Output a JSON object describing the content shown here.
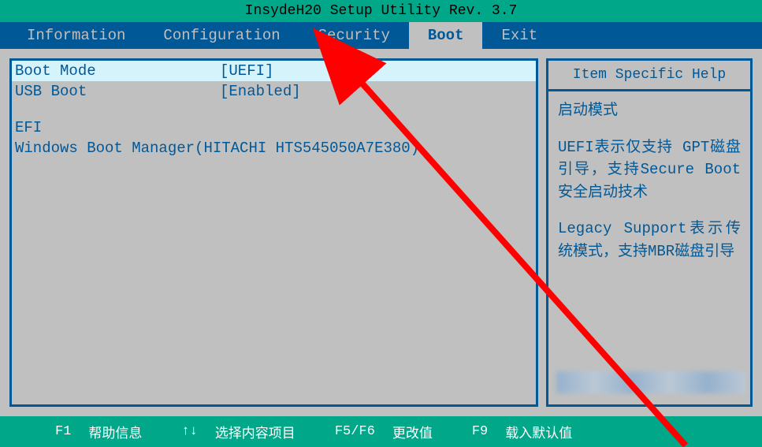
{
  "title": "InsydeH20 Setup Utility Rev. 3.7",
  "menu": {
    "items": [
      {
        "label": "Information",
        "active": false
      },
      {
        "label": "Configuration",
        "active": false
      },
      {
        "label": "Security",
        "active": false
      },
      {
        "label": "Boot",
        "active": true
      },
      {
        "label": "Exit",
        "active": false
      }
    ]
  },
  "main": {
    "rows": [
      {
        "label": "Boot Mode",
        "value": "[UEFI]",
        "highlighted": true
      },
      {
        "label": "USB Boot",
        "value": "[Enabled]",
        "highlighted": false
      }
    ],
    "efi_section": "EFI",
    "boot_entry": "Windows Boot Manager(HITACHI HTS545050A7E380)"
  },
  "help": {
    "title": "Item Specific Help",
    "p1": "启动模式",
    "p2": "UEFI表示仅支持 GPT磁盘引导，支持Secure Boot安全启动技术",
    "p3": "Legacy Support表示传统模式，支持MBR磁盘引导"
  },
  "footer": {
    "items": [
      {
        "key": "F1",
        "desc": "帮助信息"
      },
      {
        "key": "↑↓",
        "desc": "选择内容项目"
      },
      {
        "key": "F5/F6",
        "desc": "更改值"
      },
      {
        "key": "F9",
        "desc": "载入默认值"
      }
    ]
  }
}
